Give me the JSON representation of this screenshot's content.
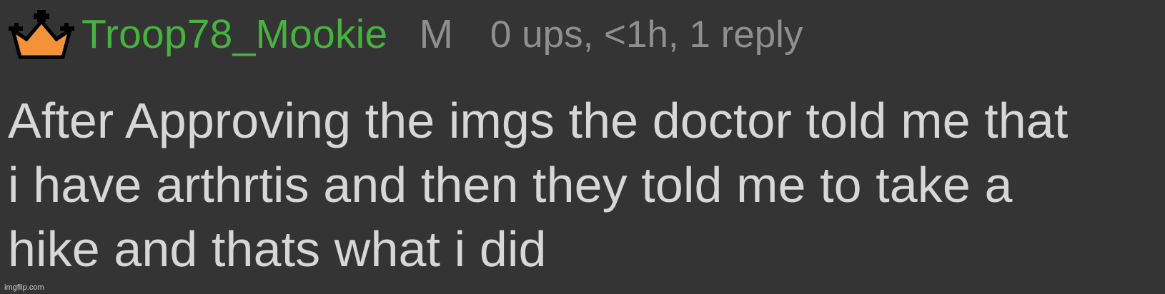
{
  "comment": {
    "username": "Troop78_Mookie",
    "gender": "M",
    "meta": "0 ups, <1h, 1 reply",
    "body_lines": [
      "After Approving the imgs the doctor told me that",
      "i have arthrtis and then they told me to take a",
      "hike and thats what i did"
    ]
  },
  "badge": {
    "icon": "crown-icon",
    "fill_color": "#f39237",
    "outline_color": "#000000"
  },
  "colors": {
    "background": "#343434",
    "username": "#46b33e",
    "meta": "#8f8f8f",
    "body": "#d7d7d7"
  },
  "watermark": "imgflip.com"
}
